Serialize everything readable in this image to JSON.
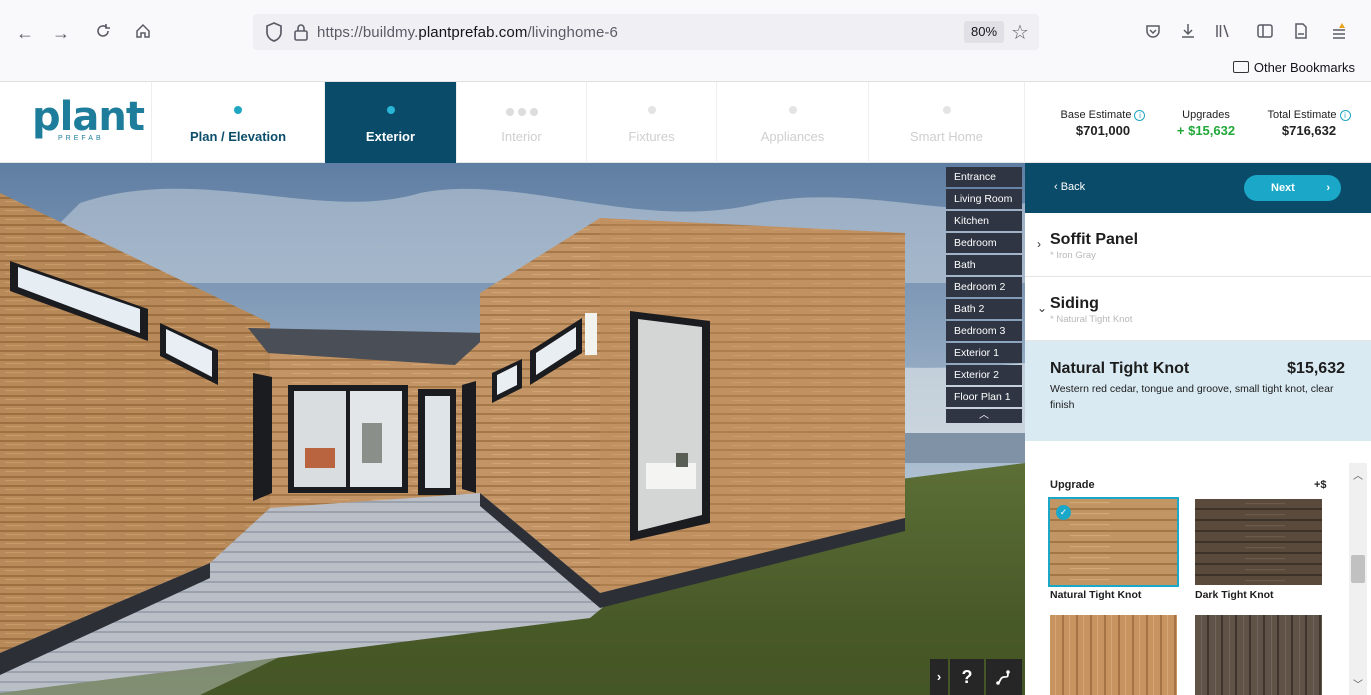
{
  "browser": {
    "url_prefix": "https://buildmy.",
    "url_domain": "plantprefab.com",
    "url_path": "/livinghome-6",
    "zoom": "80%",
    "other_bookmarks": "Other Bookmarks"
  },
  "brand": {
    "logo_text": "plant",
    "logo_sub": "PREFAB",
    "color": "#1e7d9b"
  },
  "steps": [
    {
      "label": "Plan / Elevation",
      "state": "done"
    },
    {
      "label": "Exterior",
      "state": "active"
    },
    {
      "label": "Interior",
      "state": "disabled"
    },
    {
      "label": "Fixtures",
      "state": "disabled"
    },
    {
      "label": "Appliances",
      "state": "disabled"
    },
    {
      "label": "Smart Home",
      "state": "disabled"
    }
  ],
  "estimates": {
    "base_label": "Base Estimate",
    "base_value": "$701,000",
    "upgrades_label": "Upgrades",
    "upgrades_value": "+ $15,632",
    "total_label": "Total Estimate",
    "total_value": "$716,632"
  },
  "rooms": [
    "Entrance",
    "Living Room",
    "Kitchen",
    "Bedroom",
    "Bath",
    "Bedroom 2",
    "Bath 2",
    "Bedroom 3",
    "Exterior 1",
    "Exterior 2",
    "Floor Plan 1"
  ],
  "viewer_controls": {
    "help": "?"
  },
  "panel": {
    "back": "‹ Back",
    "next": "Next",
    "sections": [
      {
        "title": "Soffit Panel",
        "subtitle": "* Iron Gray",
        "expanded": false
      },
      {
        "title": "Siding",
        "subtitle": "* Natural Tight Knot",
        "expanded": true
      }
    ],
    "selected": {
      "name": "Natural Tight Knot",
      "price": "$15,632",
      "description": "Western red cedar, tongue and groove, small tight knot, clear finish"
    },
    "upgrade_label": "Upgrade",
    "upgrade_cost_label": "+$",
    "options": [
      {
        "name": "Natural Tight Knot",
        "selected": true
      },
      {
        "name": "Dark Tight Knot",
        "selected": false
      },
      {
        "name": "",
        "selected": false
      },
      {
        "name": "",
        "selected": false
      }
    ]
  },
  "colors": {
    "navy": "#0a4b69",
    "accent": "#1ba7c7",
    "green": "#22a83a"
  }
}
